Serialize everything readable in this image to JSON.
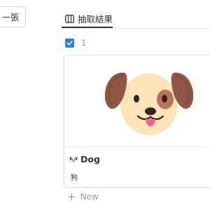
{
  "left_button": {
    "label": "一張"
  },
  "tab": {
    "label": "抽取結果",
    "icon": "table-icon"
  },
  "result": {
    "checked": true,
    "count": "1"
  },
  "card": {
    "cover_icon": "dog-face-icon",
    "title": "Dog",
    "title_icon": "dog-face-icon",
    "property_value": "狗"
  },
  "new_item": {
    "label": "New",
    "icon": "plus-icon"
  },
  "colors": {
    "accent": "#2383e2",
    "text": "#37352f",
    "muted": "#9b9a97",
    "border": "#e3e2e0"
  }
}
